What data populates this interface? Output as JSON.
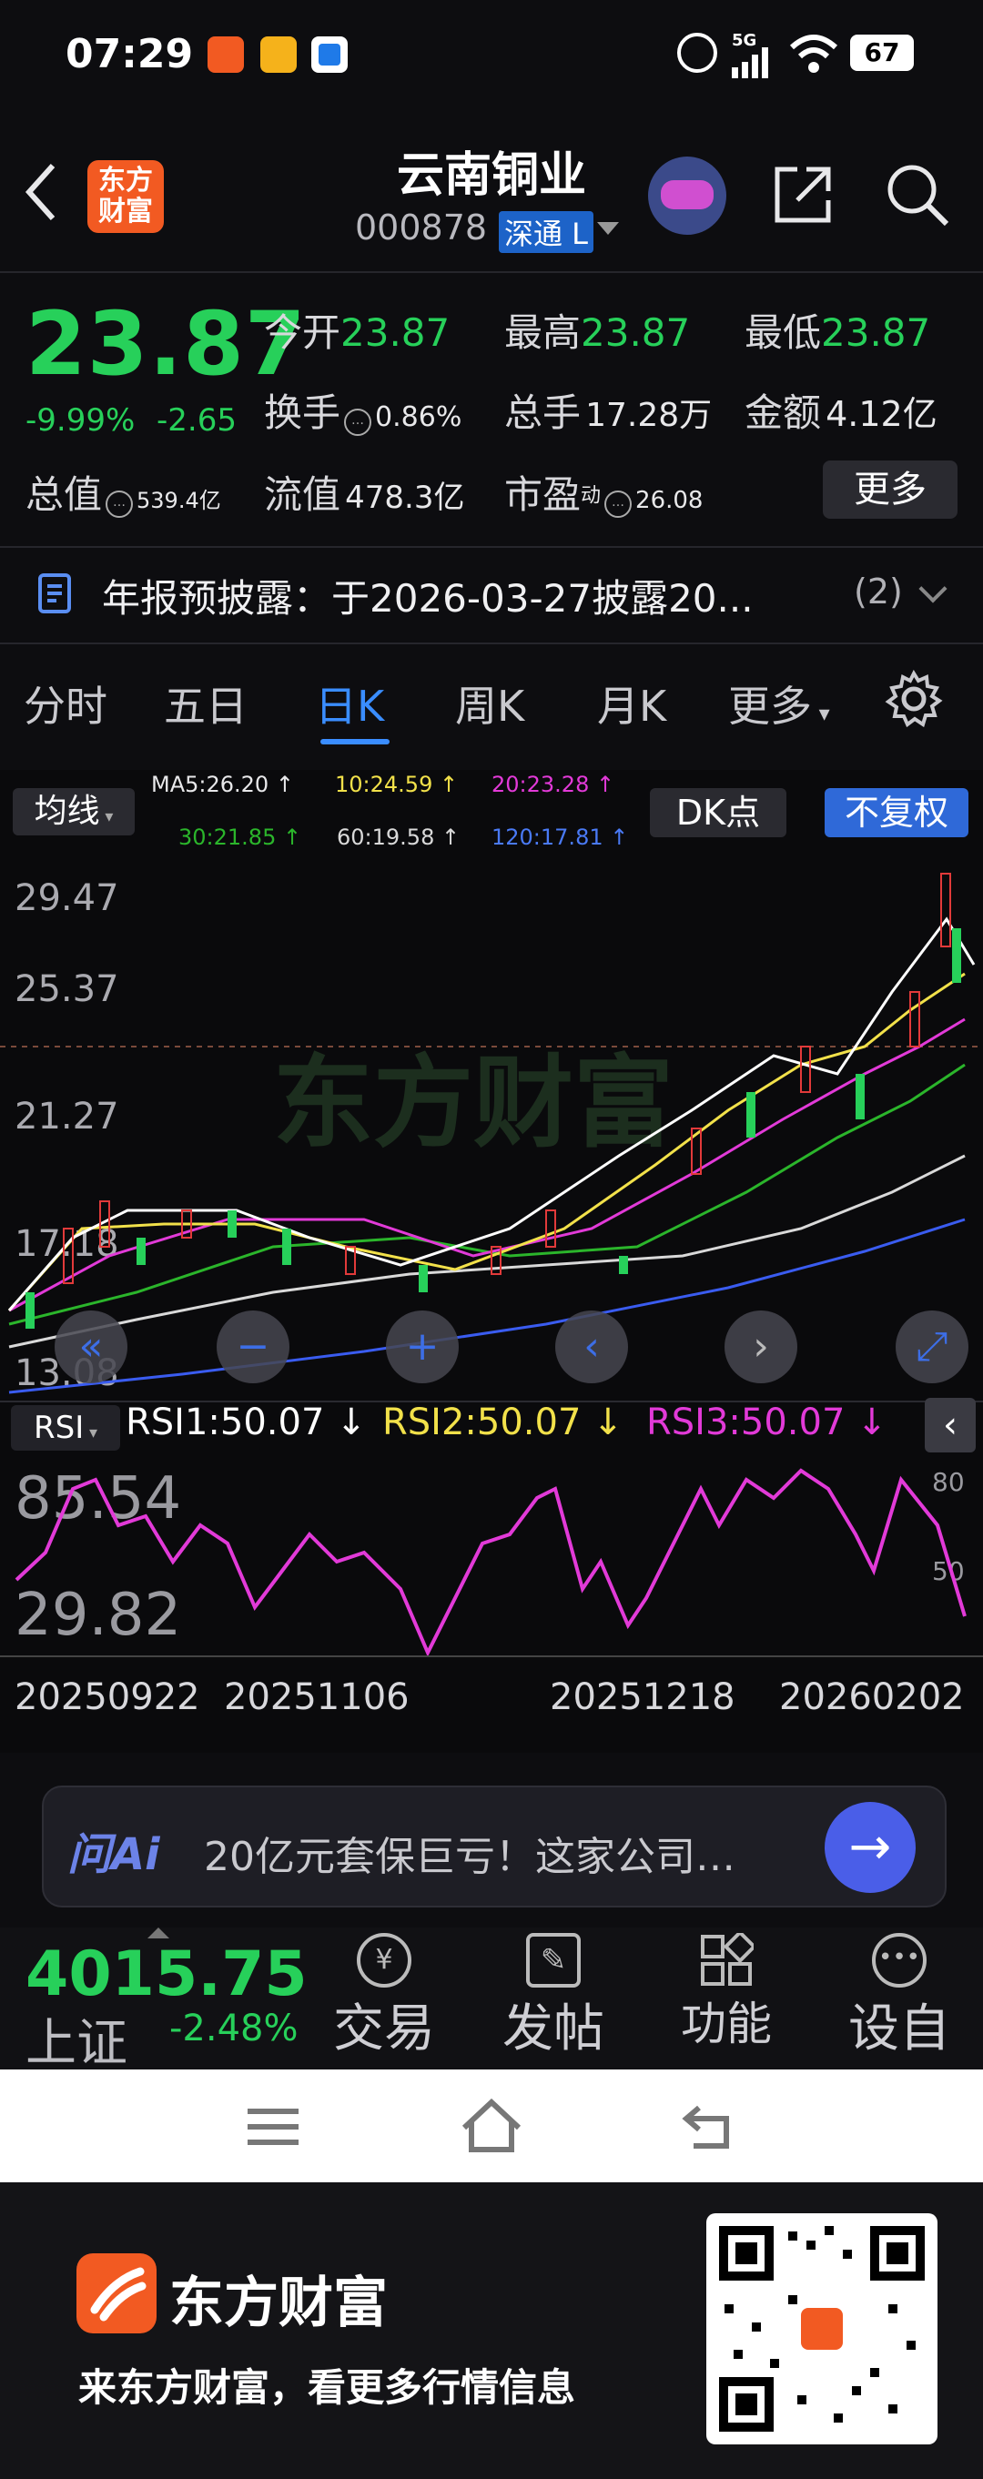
{
  "status": {
    "time": "07:29",
    "battery": "67",
    "net": "5G"
  },
  "header": {
    "logo_line1": "东方",
    "logo_line2": "财富",
    "title": "云南铜业",
    "code": "000878",
    "code_tag": "深通 L"
  },
  "quote": {
    "price": "23.87",
    "pct": "-9.99%",
    "chg": "-2.65",
    "open_label": "今开",
    "open": "23.87",
    "high_label": "最高",
    "high": "23.87",
    "low_label": "最低",
    "low": "23.87",
    "turnover_label": "换手",
    "turnover": "0.86%",
    "volume_label": "总手",
    "volume": "17.28万",
    "amount_label": "金额",
    "amount": "4.12亿",
    "mktcap_label": "总值",
    "mktcap": "539.4亿",
    "float_label": "流值",
    "float": "478.3亿",
    "pe_label": "市盈",
    "pe_sup": "动",
    "pe": "26.08",
    "more_label": "更多"
  },
  "notice": {
    "text": "年报预披露：于2026-03-27披露20...",
    "count": "(2)"
  },
  "tabs": [
    "分时",
    "五日",
    "日K",
    "周K",
    "月K",
    "更多"
  ],
  "indicator": {
    "ma_label": "均线",
    "dk_label": "DK点",
    "fq_label": "不复权",
    "ma5": "MA5:26.20 ↑",
    "ma10": "10:24.59 ↑",
    "ma20": "20:23.28 ↑",
    "ma30": "30:21.85 ↑",
    "ma60": "60:19.58 ↑",
    "ma120": "120:17.81 ↑",
    "colors": {
      "ma5": "#ffffff",
      "ma10": "#f2e14a",
      "ma20": "#e23ad8",
      "ma30": "#2bb52b",
      "ma60": "#d9d9d9",
      "ma120": "#3a5cf0"
    }
  },
  "kline": {
    "yticks": [
      "29.47",
      "25.37",
      "21.27",
      "17.18",
      "13.08"
    ],
    "watermark": "东方财富",
    "controls": [
      "«",
      "−",
      "+",
      "‹",
      "›",
      "⤢"
    ]
  },
  "rsi": {
    "label": "RSI",
    "rsi1": "RSI1:50.07 ↓",
    "rsi2": "RSI2:50.07 ↓",
    "rsi3": "RSI3:50.07 ↓",
    "y_high": "85.54",
    "y_low": "29.82",
    "r80": "80",
    "r50": "50",
    "dates": [
      "20250922",
      "20251106",
      "20251218",
      "20260202"
    ]
  },
  "ask": {
    "brand": "问Ai",
    "text": "20亿元套保巨亏！这家公司…"
  },
  "bottom": {
    "index_value": "4015.75",
    "index_name": "上证",
    "index_pct": "-2.48%",
    "items": [
      "交易",
      "发帖",
      "功能",
      "设自"
    ]
  },
  "footer": {
    "brand": "东方财富",
    "slogan": "来东方财富，看更多行情信息"
  }
}
